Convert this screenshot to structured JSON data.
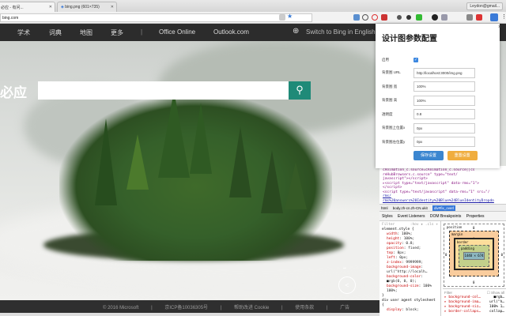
{
  "browser": {
    "tabs": [
      {
        "label": "必应 - 有问..."
      },
      {
        "label": "bing.png (601×735)"
      }
    ],
    "user": "Leydon@gmail...",
    "url": "bing.com"
  },
  "bing": {
    "nav": [
      "学术",
      "词典",
      "地图",
      "更多",
      "|",
      "Office Online",
      "Outlook.com"
    ],
    "switch_lang": "Switch to Bing in English",
    "logo": "必应",
    "search_placeholder": "",
    "footer": [
      "© 2016 Microsoft",
      "|",
      "京ICP备10036305号",
      "|",
      "帮助改进 Cookie",
      "|",
      "使用条款",
      "|",
      "广告"
    ]
  },
  "popup": {
    "title": "设计图参数配置",
    "fields": [
      {
        "label": "启用",
        "type": "checkbox",
        "checked": true
      },
      {
        "label": "背景图 URL",
        "value": "http://localhost:3000/img.png"
      },
      {
        "label": "背景图 宽",
        "value": "100%"
      },
      {
        "label": "背景图 高",
        "value": "100%"
      },
      {
        "label": "透明度",
        "value": "0.8"
      },
      {
        "label": "背景图上位置x",
        "value": "0px"
      },
      {
        "label": "背景图左位置y",
        "value": "0px"
      }
    ],
    "save_label": "保存设置",
    "reset_label": "重置设置",
    "close": "×"
  },
  "devtools": {
    "code": [
      "cAnimation_c.source=cAnimation_c.source||cs",
      "reHubBrowsers.c.source\" type=\"text/",
      "javascript\"></script>",
      "▸<script type=\"text/javascript\" data-rms=\"1\">",
      "</script>",
      "<script type=\"text/javascript\" data-rms=\"1\" src=\"/",
      "rms/",
      "rms%20answers%20Identity%20Blue%24BlueIdentityDropdo"
    ],
    "breadcrumb": [
      "html",
      "body.zh-cn.zh-CN.ukit",
      "div#fix_overl"
    ],
    "tabs": [
      "Styles",
      "Event Listeners",
      "DOM Breakpoints",
      "Properties"
    ],
    "filter": "Filter",
    "filter_tools": ":hov  ✚  .cls  +",
    "styles": [
      {
        "sel": "element.style {"
      },
      {
        "p": "width",
        "v": "100%;"
      },
      {
        "p": "height",
        "v": "100%;"
      },
      {
        "p": "opacity",
        "v": "0.8;"
      },
      {
        "p": "position",
        "v": "fixed;"
      },
      {
        "p": "top",
        "v": "0px;"
      },
      {
        "p": "left",
        "v": "0px;"
      },
      {
        "p": "z-index",
        "v": "9999999;"
      },
      {
        "p": "background-image",
        "v": "url(\"http://localh…"
      },
      {
        "p": "background-color",
        "v": "■rgb(0, 0, 0);"
      },
      {
        "p": "background-size",
        "v": "100% 100%;"
      },
      {
        "sel": "}"
      },
      {
        "sel": "div  user agent stylesheet {"
      },
      {
        "p": "display",
        "v": "block;"
      }
    ],
    "box": {
      "position": "position",
      "margin": "margin",
      "border": "border",
      "padding": "padding",
      "content": "1440 × 674",
      "zero": "0",
      "dash": "-"
    },
    "computed_filter": "Filter",
    "show_all": "Show all",
    "computed": [
      {
        "p": "background-col…",
        "v": "■rgb…"
      },
      {
        "p": "background-ima…",
        "v": "url(\"h…"
      },
      {
        "p": "background-siz…",
        "v": "100% 1…"
      },
      {
        "p": "border-collaps…",
        "v": "collap…"
      }
    ]
  }
}
